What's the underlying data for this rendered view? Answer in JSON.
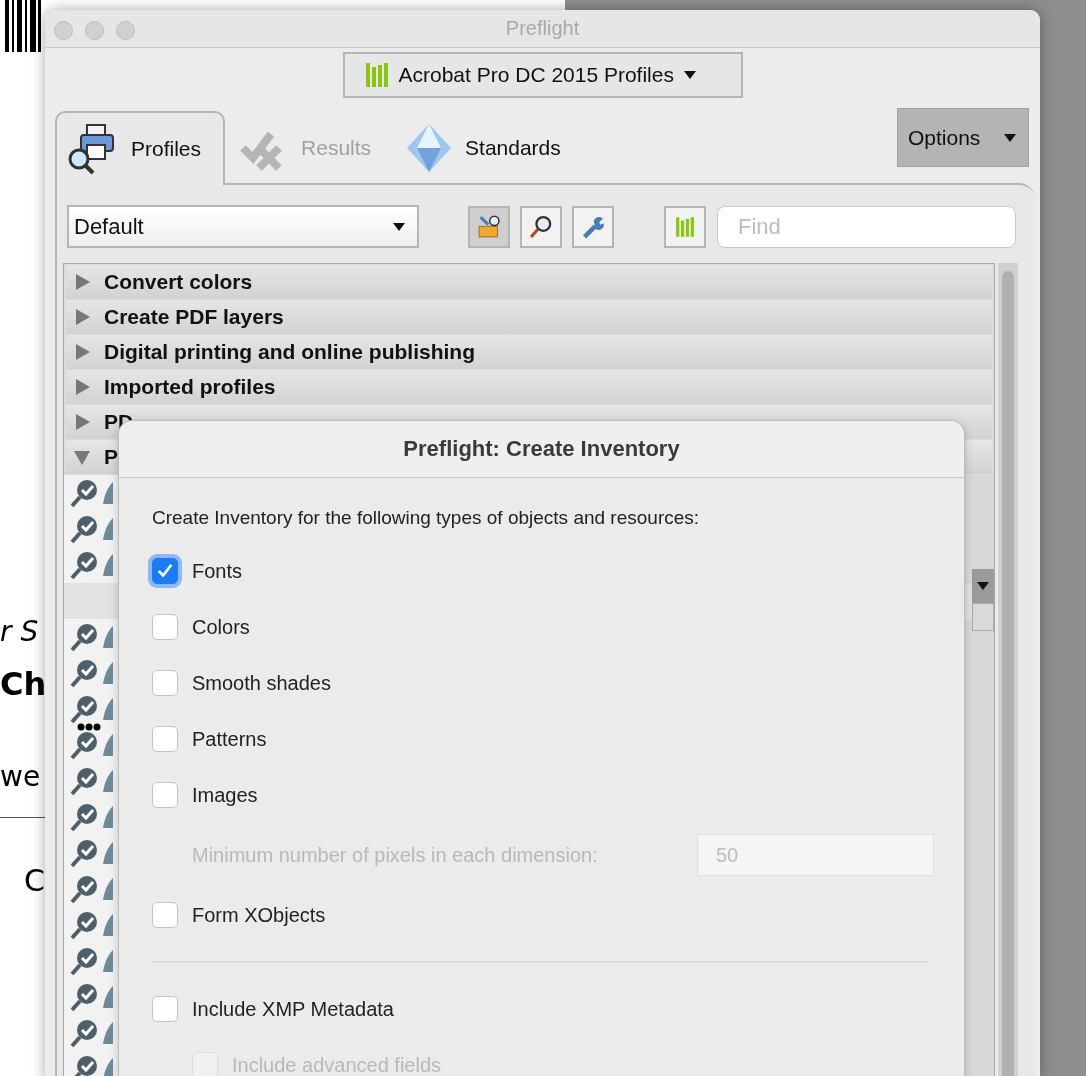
{
  "background_document": {
    "fragments": [
      {
        "kind": "italic",
        "text": "r S"
      },
      {
        "kind": "bold",
        "text": "Ch"
      },
      {
        "kind": "plain",
        "text": "we"
      },
      {
        "kind": "rule"
      },
      {
        "kind": "large",
        "text": "C"
      }
    ]
  },
  "window": {
    "title": "Preflight"
  },
  "profile_set": {
    "label": "Acrobat Pro DC 2015 Profiles"
  },
  "tabs": [
    {
      "label": "Profiles",
      "selected": true,
      "disabled": false
    },
    {
      "label": "Results",
      "selected": false,
      "disabled": true
    },
    {
      "label": "Standards",
      "selected": false,
      "disabled": false
    }
  ],
  "options_button": {
    "label": "Options"
  },
  "toolbar": {
    "profile_filter": {
      "value": "Default"
    },
    "find": {
      "placeholder": "Find"
    }
  },
  "profile_groups": [
    {
      "label": "Convert colors",
      "expanded": false
    },
    {
      "label": "Create PDF layers",
      "expanded": false
    },
    {
      "label": "Digital printing and online publishing",
      "expanded": false
    },
    {
      "label": "Imported profiles",
      "expanded": false
    },
    {
      "label": "PD",
      "expanded": false
    },
    {
      "label": "P",
      "expanded": true,
      "children": [
        {
          "kind": "profile",
          "pending": false
        },
        {
          "kind": "profile",
          "pending": false
        },
        {
          "kind": "profile",
          "pending": false
        },
        {
          "kind": "editor"
        },
        {
          "kind": "profile",
          "pending": false
        },
        {
          "kind": "profile",
          "pending": false
        },
        {
          "kind": "profile",
          "pending": false
        },
        {
          "kind": "profile",
          "pending": true
        },
        {
          "kind": "profile",
          "pending": false
        },
        {
          "kind": "profile",
          "pending": false
        },
        {
          "kind": "profile",
          "pending": false
        },
        {
          "kind": "profile",
          "pending": false
        },
        {
          "kind": "profile",
          "pending": false
        },
        {
          "kind": "profile",
          "pending": false
        },
        {
          "kind": "profile",
          "pending": false
        },
        {
          "kind": "profile",
          "pending": false
        },
        {
          "kind": "profile",
          "pending": false
        }
      ]
    }
  ],
  "sheet": {
    "title": "Preflight: Create Inventory",
    "intro": "Create Inventory for the following types of objects and resources:",
    "options": [
      {
        "kind": "checkbox",
        "label": "Fonts",
        "checked": true,
        "disabled": false
      },
      {
        "kind": "checkbox",
        "label": "Colors",
        "checked": false,
        "disabled": false
      },
      {
        "kind": "checkbox",
        "label": "Smooth shades",
        "checked": false,
        "disabled": false
      },
      {
        "kind": "checkbox",
        "label": "Patterns",
        "checked": false,
        "disabled": false
      },
      {
        "kind": "checkbox",
        "label": "Images",
        "checked": false,
        "disabled": false,
        "children": [
          {
            "kind": "number",
            "label": "Minimum number of pixels in each dimension:",
            "value": "50",
            "disabled": true
          }
        ]
      },
      {
        "kind": "checkbox",
        "label": "Form XObjects",
        "checked": false,
        "disabled": false
      },
      {
        "kind": "separator"
      },
      {
        "kind": "checkbox",
        "label": "Include XMP Metadata",
        "checked": false,
        "disabled": false,
        "children": [
          {
            "kind": "checkbox",
            "label": "Include advanced fields",
            "checked": false,
            "disabled": true
          }
        ]
      }
    ]
  }
}
